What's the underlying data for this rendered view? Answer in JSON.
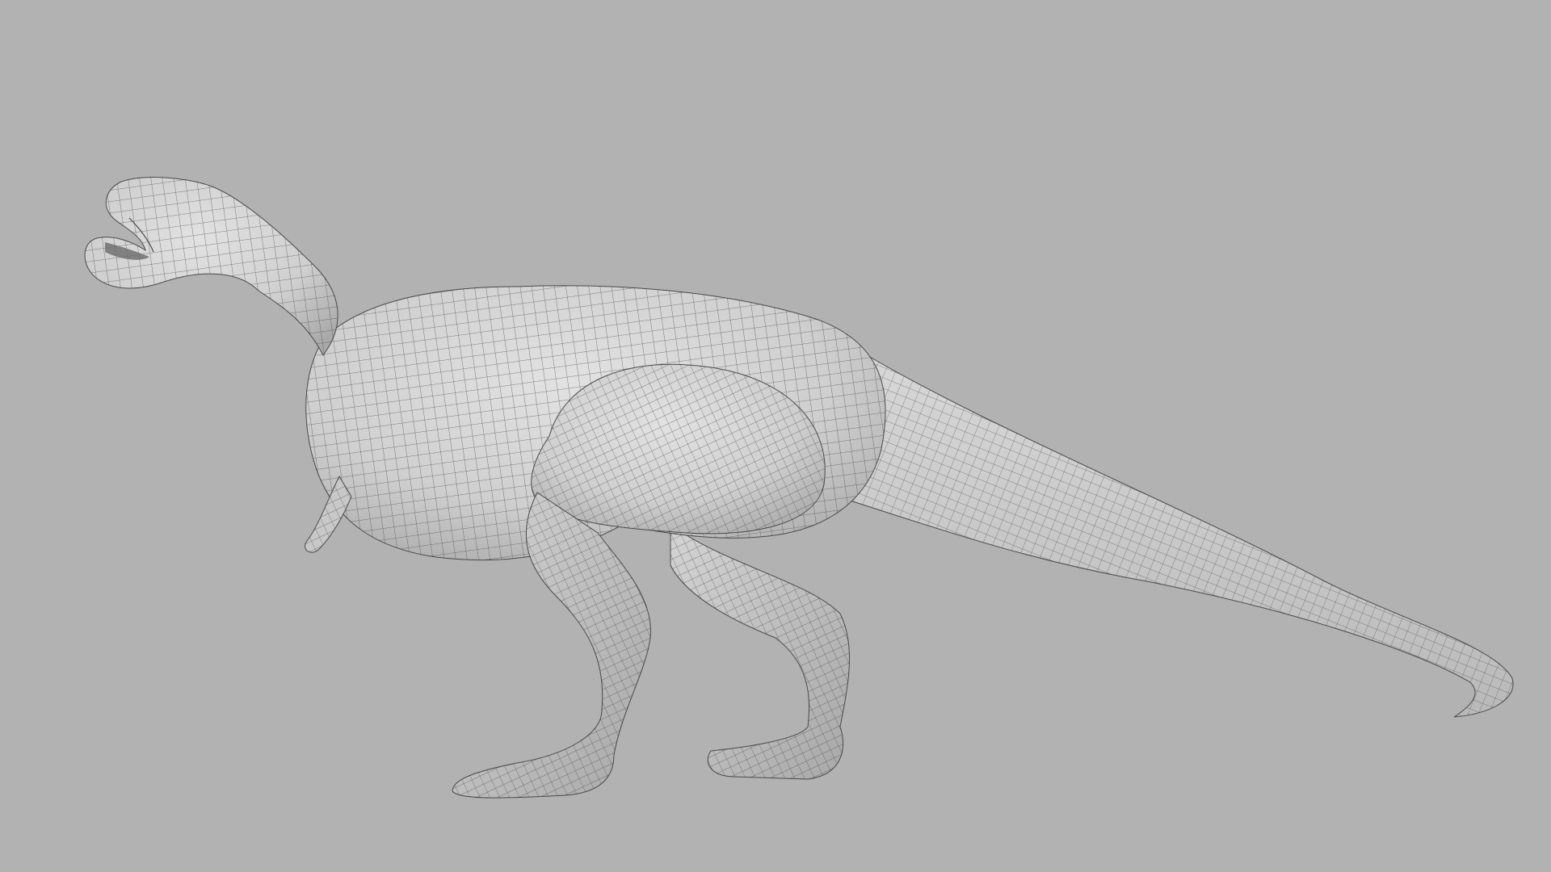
{
  "viewport": {
    "background": "#b2b2b2",
    "model": {
      "subject": "t-rex",
      "display_mode": "wireframe-on-shaded",
      "surface_color": "#d6d6d6",
      "wire_color": "#3a3a3a"
    }
  }
}
